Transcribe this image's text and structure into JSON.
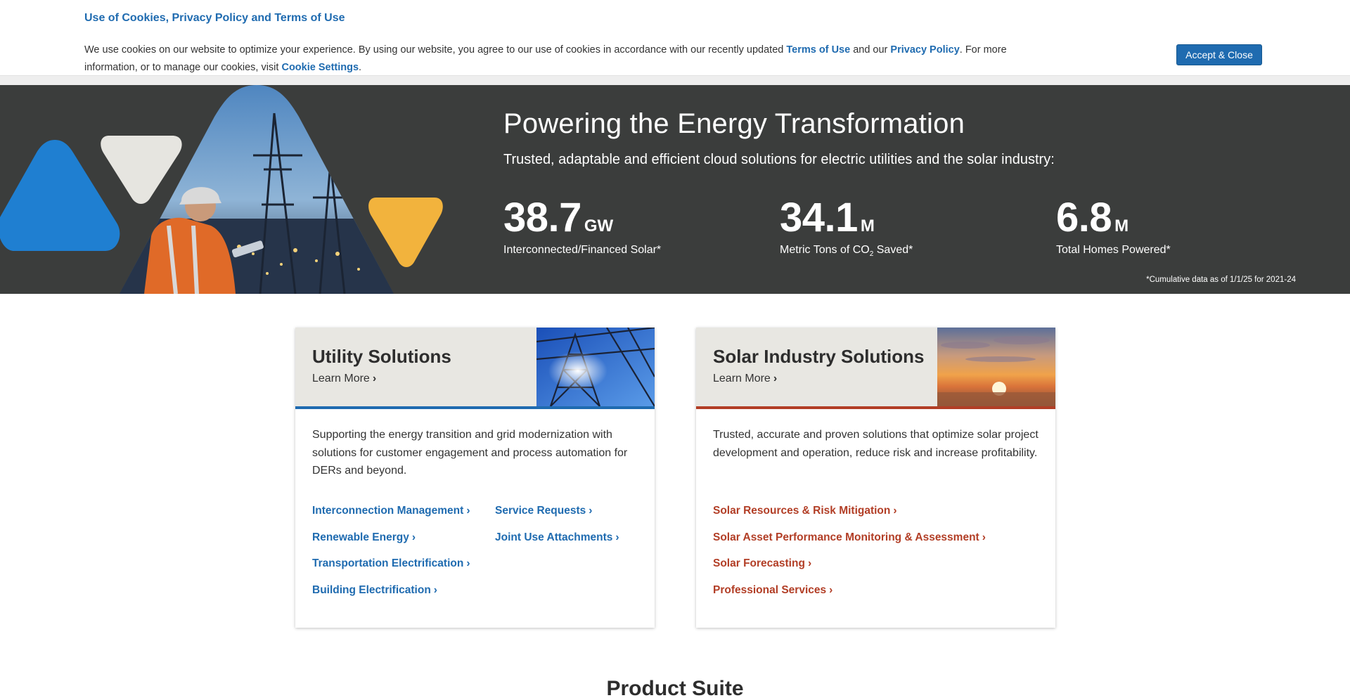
{
  "cookie_banner": {
    "title": "Use of Cookies, Privacy Policy and Terms of Use",
    "text_1": "We use cookies on our website to optimize your experience. By using our website, you agree to our use of cookies in accordance with our recently updated ",
    "terms_link": "Terms of Use",
    "text_2": " and our ",
    "privacy_link": "Privacy Policy",
    "text_3": ". For more information, or to manage our cookies, visit ",
    "settings_link": "Cookie Settings",
    "text_4": ".",
    "accept_label": "Accept & Close"
  },
  "hero": {
    "title": "Powering the Energy Transformation",
    "subtitle": "Trusted, adaptable and efficient cloud solutions for electric utilities and the solar industry:",
    "stats": [
      {
        "value": "38.7",
        "unit": "GW",
        "label": "Interconnected/Financed Solar*"
      },
      {
        "value": "34.1",
        "unit": "M",
        "label_pre": "Metric Tons of CO",
        "label_sub": "2",
        "label_post": " Saved*"
      },
      {
        "value": "6.8",
        "unit": "M",
        "label": "Total Homes Powered*"
      }
    ],
    "footnote": "*Cumulative data as of 1/1/25 for 2021-24"
  },
  "cards": {
    "utility": {
      "title": "Utility Solutions",
      "learn_more": "Learn More",
      "description": "Supporting the energy transition and grid modernization with solutions for customer engagement and process automation for DERs and beyond.",
      "links": [
        "Interconnection Management",
        "Service Requests",
        "Renewable Energy",
        "Joint Use Attachments",
        "Transportation Electrification",
        "Building Electrification"
      ],
      "accent": "#1f6bb0"
    },
    "solar": {
      "title": "Solar Industry Solutions",
      "learn_more": "Learn More",
      "description": "Trusted, accurate and proven solutions that optimize solar project development and operation, reduce risk and increase profitability.",
      "links": [
        "Solar Resources & Risk Mitigation",
        "Solar Asset Performance Monitoring & Assessment",
        "Solar Forecasting",
        "Professional Services"
      ],
      "accent": "#b23e26"
    }
  },
  "product_suite": {
    "title": "Product Suite"
  },
  "icons": {
    "chevron": "chevron-right-icon"
  },
  "colors": {
    "hero_bg": "#3b3d3c",
    "blue": "#1f6bb0",
    "red": "#b23e26",
    "yellow": "#f2b33d",
    "card_head": "#e8e7e2"
  }
}
